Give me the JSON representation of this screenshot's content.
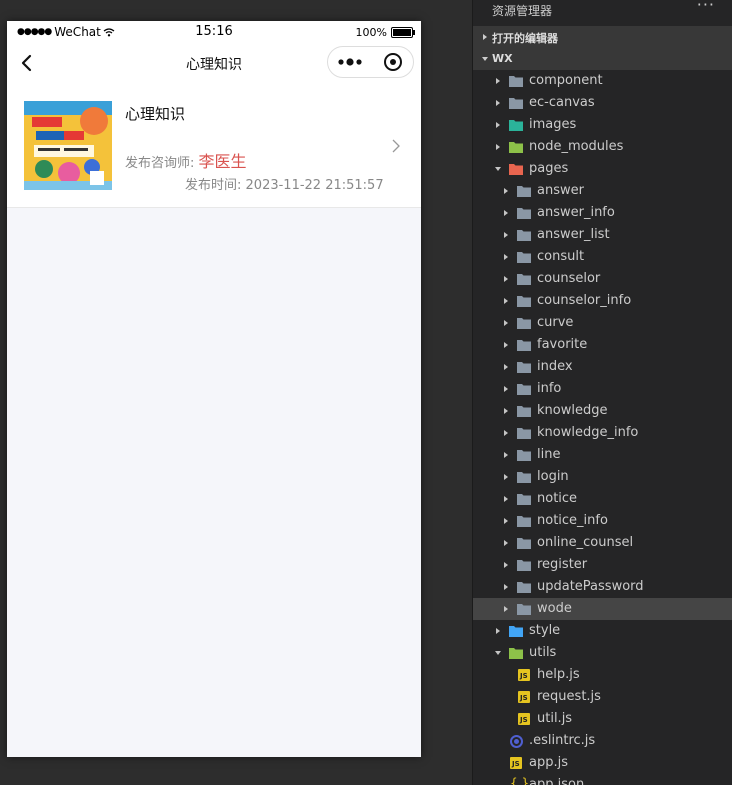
{
  "phone": {
    "status": {
      "carrier": "WeChat",
      "time": "15:16",
      "battery": "100%"
    },
    "nav": {
      "title": "心理知识"
    },
    "card": {
      "title": "心理知识",
      "author_label": "发布咨询师:",
      "author_name": "李医生",
      "time_label": "发布时间:",
      "time_value": "2023-11-22 21:51:57"
    }
  },
  "explorer": {
    "title": "资源管理器",
    "more": "···",
    "open_editors": "打开的编辑器",
    "project": "WX",
    "items": [
      {
        "name": "component",
        "depth": 0,
        "type": "folder",
        "expanded": false,
        "icon_color": "#8a97a5"
      },
      {
        "name": "ec-canvas",
        "depth": 0,
        "type": "folder",
        "expanded": false,
        "icon_color": "#8a97a5"
      },
      {
        "name": "images",
        "depth": 0,
        "type": "folder",
        "expanded": false,
        "icon_color": "#2bb39a"
      },
      {
        "name": "node_modules",
        "depth": 0,
        "type": "folder",
        "expanded": false,
        "icon_color": "#8dc149"
      },
      {
        "name": "pages",
        "depth": 0,
        "type": "folder",
        "expanded": true,
        "icon_color": "#e8654f"
      },
      {
        "name": "answer",
        "depth": 1,
        "type": "folder",
        "expanded": false,
        "icon_color": "#8a97a5"
      },
      {
        "name": "answer_info",
        "depth": 1,
        "type": "folder",
        "expanded": false,
        "icon_color": "#8a97a5"
      },
      {
        "name": "answer_list",
        "depth": 1,
        "type": "folder",
        "expanded": false,
        "icon_color": "#8a97a5"
      },
      {
        "name": "consult",
        "depth": 1,
        "type": "folder",
        "expanded": false,
        "icon_color": "#8a97a5"
      },
      {
        "name": "counselor",
        "depth": 1,
        "type": "folder",
        "expanded": false,
        "icon_color": "#8a97a5"
      },
      {
        "name": "counselor_info",
        "depth": 1,
        "type": "folder",
        "expanded": false,
        "icon_color": "#8a97a5"
      },
      {
        "name": "curve",
        "depth": 1,
        "type": "folder",
        "expanded": false,
        "icon_color": "#8a97a5"
      },
      {
        "name": "favorite",
        "depth": 1,
        "type": "folder",
        "expanded": false,
        "icon_color": "#8a97a5"
      },
      {
        "name": "index",
        "depth": 1,
        "type": "folder",
        "expanded": false,
        "icon_color": "#8a97a5"
      },
      {
        "name": "info",
        "depth": 1,
        "type": "folder",
        "expanded": false,
        "icon_color": "#8a97a5"
      },
      {
        "name": "knowledge",
        "depth": 1,
        "type": "folder",
        "expanded": false,
        "icon_color": "#8a97a5"
      },
      {
        "name": "knowledge_info",
        "depth": 1,
        "type": "folder",
        "expanded": false,
        "icon_color": "#8a97a5"
      },
      {
        "name": "line",
        "depth": 1,
        "type": "folder",
        "expanded": false,
        "icon_color": "#8a97a5"
      },
      {
        "name": "login",
        "depth": 1,
        "type": "folder",
        "expanded": false,
        "icon_color": "#8a97a5"
      },
      {
        "name": "notice",
        "depth": 1,
        "type": "folder",
        "expanded": false,
        "icon_color": "#8a97a5"
      },
      {
        "name": "notice_info",
        "depth": 1,
        "type": "folder",
        "expanded": false,
        "icon_color": "#8a97a5"
      },
      {
        "name": "online_counsel",
        "depth": 1,
        "type": "folder",
        "expanded": false,
        "icon_color": "#8a97a5"
      },
      {
        "name": "register",
        "depth": 1,
        "type": "folder",
        "expanded": false,
        "icon_color": "#8a97a5"
      },
      {
        "name": "updatePassword",
        "depth": 1,
        "type": "folder",
        "expanded": false,
        "icon_color": "#8a97a5"
      },
      {
        "name": "wode",
        "depth": 1,
        "type": "folder",
        "expanded": false,
        "icon_color": "#8a97a5",
        "selected": true
      },
      {
        "name": "style",
        "depth": 0,
        "type": "folder",
        "expanded": false,
        "icon_color": "#42a5f5"
      },
      {
        "name": "utils",
        "depth": 0,
        "type": "folder",
        "expanded": true,
        "icon_color": "#8dc149"
      },
      {
        "name": "help.js",
        "depth": 1,
        "type": "js"
      },
      {
        "name": "request.js",
        "depth": 1,
        "type": "js"
      },
      {
        "name": "util.js",
        "depth": 1,
        "type": "js"
      },
      {
        "name": ".eslintrc.js",
        "depth": 0,
        "type": "config"
      },
      {
        "name": "app.js",
        "depth": 0,
        "type": "js"
      },
      {
        "name": "app.json",
        "depth": 0,
        "type": "json"
      }
    ]
  }
}
